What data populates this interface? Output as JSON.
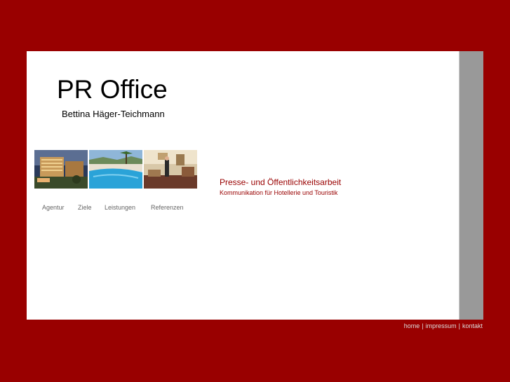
{
  "brand": {
    "title": "PR Office",
    "subtitle": "Bettina Häger-Teichmann"
  },
  "photos": [
    {
      "icon": "hotel-exterior-photo"
    },
    {
      "icon": "pool-photo"
    },
    {
      "icon": "hotel-lobby-photo"
    }
  ],
  "nav": {
    "items": [
      {
        "label": "Agentur"
      },
      {
        "label": "Ziele"
      },
      {
        "label": "Leistungen"
      },
      {
        "label": "Referenzen"
      }
    ]
  },
  "tagline": {
    "main": "Presse- und Öffentlichkeitsarbeit",
    "sub": "Kommunikation für Hotellerie und Touristik"
  },
  "footer": {
    "links": [
      {
        "label": "home"
      },
      {
        "label": "impressum"
      },
      {
        "label": "kontakt"
      }
    ],
    "separator": "|"
  },
  "colors": {
    "background": "#990000",
    "panel": "#ffffff",
    "sidebar": "#999999",
    "accent_text": "#990000",
    "nav_text": "#666666"
  }
}
